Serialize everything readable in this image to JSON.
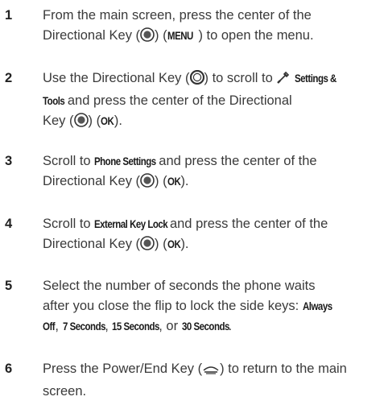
{
  "steps": [
    {
      "number": "1",
      "line1": "From the main screen, press the center of the",
      "line2_a": "Directional Key (",
      "line2_icon": "directional-key-center-icon",
      "line2_b": ") (",
      "line2_key": "MENU",
      "line2_c": ") to open the menu."
    },
    {
      "number": "2",
      "line1_a": "Use the Directional Key (",
      "line1_icon": "directional-key-icon",
      "line1_b": ") to scroll to ",
      "line1_menu_icon": "settings-tools-icon",
      "line1_key": "Settings &",
      "line2_key": "Tools",
      "line2_b": " and press the center of the Directional",
      "line3_a": "Key (",
      "line3_icon": "directional-key-center-icon",
      "line3_b": ") (",
      "line3_key": "OK",
      "line3_c": ")."
    },
    {
      "number": "3",
      "line1_a": "Scroll to ",
      "line1_key": "Phone Settings",
      "line1_b": " and press the center of the",
      "line2_a": "Directional Key (",
      "line2_icon": "directional-key-center-icon",
      "line2_b": ") (",
      "line2_key": "OK",
      "line2_c": ")."
    },
    {
      "number": "4",
      "line1_a": "Scroll to ",
      "line1_key": "External Key Lock",
      "line1_b": " and press the center of the",
      "line2_a": "Directional Key (",
      "line2_icon": "directional-key-center-icon",
      "line2_b": ") (",
      "line2_key": "OK",
      "line2_c": ")."
    },
    {
      "number": "5",
      "line1": "Select the number of seconds the phone waits",
      "line2_a": "after you close the flip to lock the side keys: ",
      "line2_key": "Always",
      "line3_key1": "Off",
      "line3_sep1": ", ",
      "line3_key2": "7 Seconds",
      "line3_sep2": ", ",
      "line3_key3": "15 Seconds",
      "line3_sep3": ", or ",
      "line3_key4": "30 Seconds",
      "line3_end": "."
    },
    {
      "number": "6",
      "line1_a": "Press the Power/End Key (",
      "line1_icon": "power-end-key-icon",
      "line1_b": ") to return to the main",
      "line2": "screen."
    }
  ]
}
